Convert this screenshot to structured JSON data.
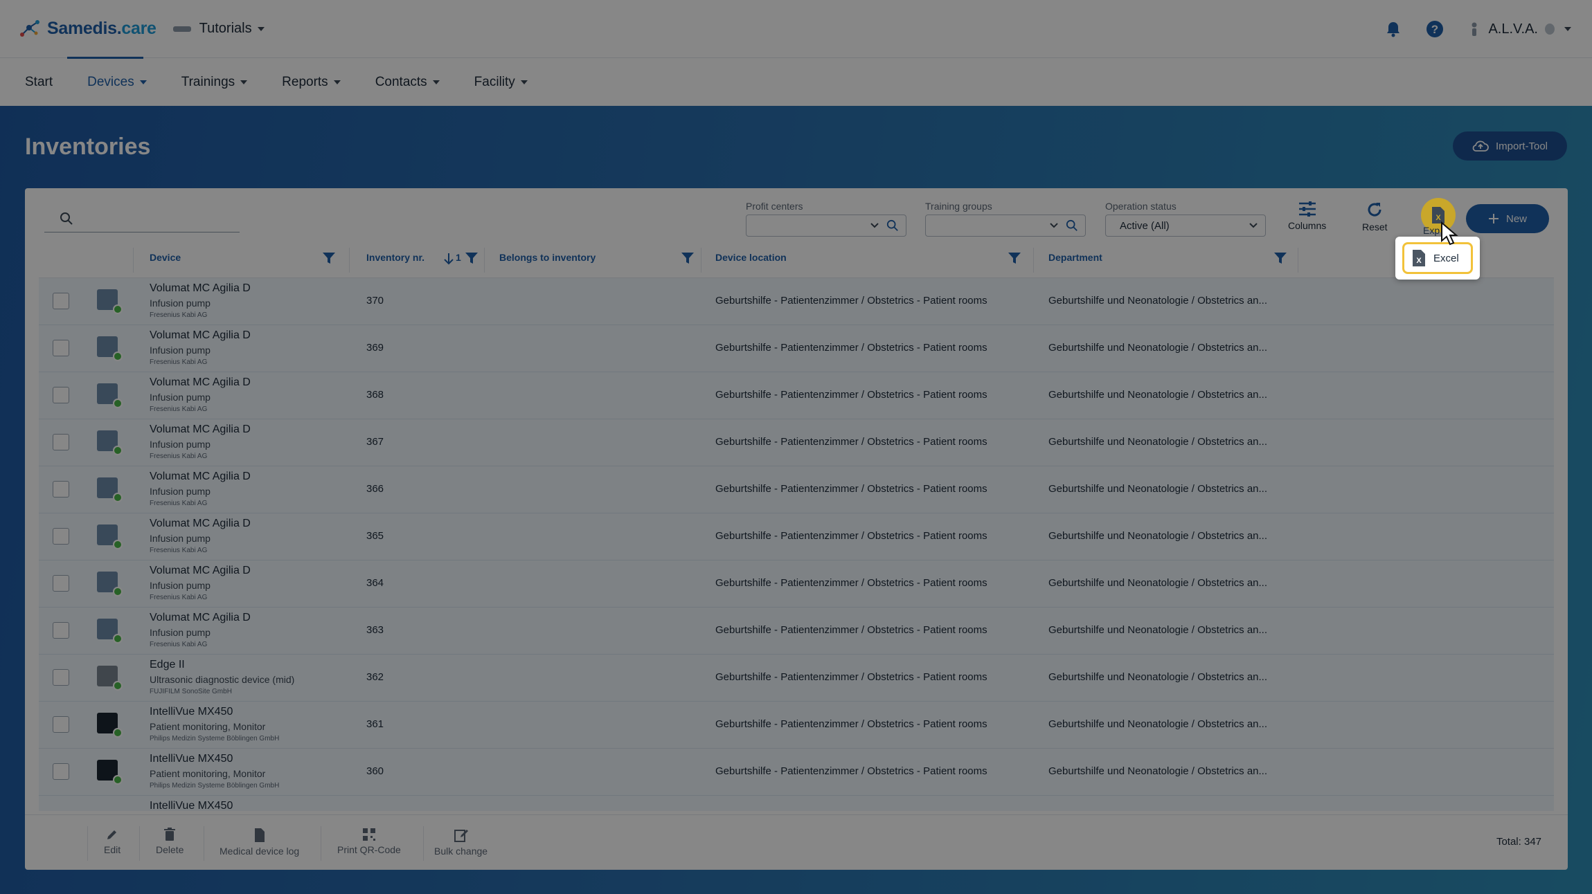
{
  "app": {
    "brand_main": "Samedis.",
    "brand_accent": "care",
    "tenant": "Tutorials",
    "user": "A.L.V.A."
  },
  "nav": {
    "start": "Start",
    "devices": "Devices",
    "trainings": "Trainings",
    "reports": "Reports",
    "contacts": "Contacts",
    "facility": "Facility"
  },
  "page": {
    "title": "Inventories",
    "import_tool": "Import-Tool"
  },
  "toolbar": {
    "search_placeholder": "",
    "profit_centers_label": "Profit centers",
    "training_groups_label": "Training groups",
    "operation_status_label": "Operation status",
    "operation_status_value": "Active (All)",
    "columns": "Columns",
    "reset": "Reset",
    "export": "Exp",
    "new": "New"
  },
  "export_menu": {
    "excel": "Excel"
  },
  "table": {
    "headers": {
      "device": "Device",
      "inventory_nr": "Inventory nr.",
      "sort_index": "1",
      "belongs_to": "Belongs to inventory",
      "location": "Device location",
      "department": "Department"
    },
    "rows": [
      {
        "name": "Volumat MC Agilia D",
        "type": "Infusion pump",
        "mfr": "Fresenius Kabi AG",
        "inv": "370",
        "loc": "Geburtshilfe - Patientenzimmer / Obstetrics - Patient rooms",
        "dept": "Geburtshilfe und Neonatologie / Obstetrics an..."
      },
      {
        "name": "Volumat MC Agilia D",
        "type": "Infusion pump",
        "mfr": "Fresenius Kabi AG",
        "inv": "369",
        "loc": "Geburtshilfe - Patientenzimmer / Obstetrics - Patient rooms",
        "dept": "Geburtshilfe und Neonatologie / Obstetrics an..."
      },
      {
        "name": "Volumat MC Agilia D",
        "type": "Infusion pump",
        "mfr": "Fresenius Kabi AG",
        "inv": "368",
        "loc": "Geburtshilfe - Patientenzimmer / Obstetrics - Patient rooms",
        "dept": "Geburtshilfe und Neonatologie / Obstetrics an..."
      },
      {
        "name": "Volumat MC Agilia D",
        "type": "Infusion pump",
        "mfr": "Fresenius Kabi AG",
        "inv": "367",
        "loc": "Geburtshilfe - Patientenzimmer / Obstetrics - Patient rooms",
        "dept": "Geburtshilfe und Neonatologie / Obstetrics an..."
      },
      {
        "name": "Volumat MC Agilia D",
        "type": "Infusion pump",
        "mfr": "Fresenius Kabi AG",
        "inv": "366",
        "loc": "Geburtshilfe - Patientenzimmer / Obstetrics - Patient rooms",
        "dept": "Geburtshilfe und Neonatologie / Obstetrics an..."
      },
      {
        "name": "Volumat MC Agilia D",
        "type": "Infusion pump",
        "mfr": "Fresenius Kabi AG",
        "inv": "365",
        "loc": "Geburtshilfe - Patientenzimmer / Obstetrics - Patient rooms",
        "dept": "Geburtshilfe und Neonatologie / Obstetrics an..."
      },
      {
        "name": "Volumat MC Agilia D",
        "type": "Infusion pump",
        "mfr": "Fresenius Kabi AG",
        "inv": "364",
        "loc": "Geburtshilfe - Patientenzimmer / Obstetrics - Patient rooms",
        "dept": "Geburtshilfe und Neonatologie / Obstetrics an..."
      },
      {
        "name": "Volumat MC Agilia D",
        "type": "Infusion pump",
        "mfr": "Fresenius Kabi AG",
        "inv": "363",
        "loc": "Geburtshilfe - Patientenzimmer / Obstetrics - Patient rooms",
        "dept": "Geburtshilfe und Neonatologie / Obstetrics an..."
      },
      {
        "name": "Edge II",
        "type": "Ultrasonic diagnostic device (mid)",
        "mfr": "FUJIFILM SonoSite GmbH",
        "inv": "362",
        "loc": "Geburtshilfe - Patientenzimmer / Obstetrics - Patient rooms",
        "dept": "Geburtshilfe und Neonatologie / Obstetrics an..."
      },
      {
        "name": "IntelliVue MX450",
        "type": "Patient monitoring, Monitor",
        "mfr": "Philips Medizin Systeme Böblingen GmbH",
        "inv": "361",
        "loc": "Geburtshilfe - Patientenzimmer / Obstetrics - Patient rooms",
        "dept": "Geburtshilfe und Neonatologie / Obstetrics an..."
      },
      {
        "name": "IntelliVue MX450",
        "type": "Patient monitoring, Monitor",
        "mfr": "Philips Medizin Systeme Böblingen GmbH",
        "inv": "360",
        "loc": "Geburtshilfe - Patientenzimmer / Obstetrics - Patient rooms",
        "dept": "Geburtshilfe und Neonatologie / Obstetrics an..."
      },
      {
        "name": "IntelliVue MX450",
        "type": "",
        "mfr": "",
        "inv": "",
        "loc": "",
        "dept": ""
      }
    ]
  },
  "footer": {
    "edit": "Edit",
    "delete": "Delete",
    "medical_device_log": "Medical device log",
    "print_qr": "Print QR-Code",
    "bulk_change": "Bulk change",
    "total": "Total: 347"
  }
}
